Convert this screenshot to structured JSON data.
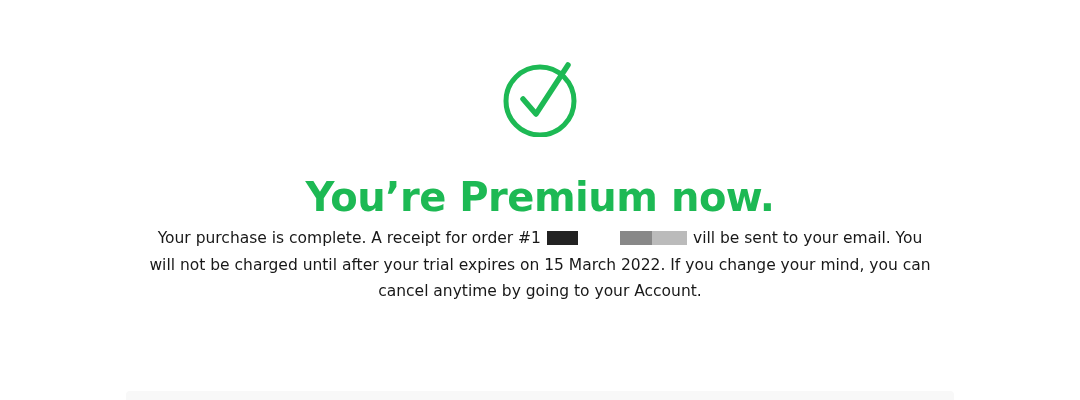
{
  "headline": "You’re Premium now.",
  "message": {
    "before": "Your purchase is complete. A receipt for order #1",
    "after": "vill be sent to your email. You",
    "rest": "will not be charged until after your trial expires on 15 March 2022. If you change your mind, you can cancel anytime by going to your Account."
  }
}
